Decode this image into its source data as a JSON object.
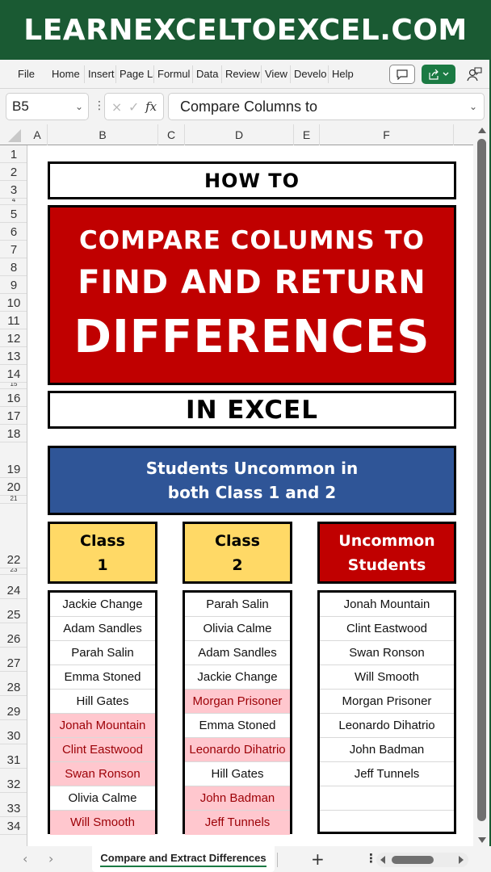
{
  "banner": {
    "text": "LEARNEXCELTOEXCEL.COM"
  },
  "ribbon": {
    "tabs": [
      "File",
      "Home",
      "Insert",
      "Page Layout",
      "Formulas",
      "Data",
      "Review",
      "View",
      "Developer",
      "Help"
    ],
    "tabs_visible": [
      "File",
      "Home",
      "Insert",
      "Page La",
      "Formul",
      "Data",
      "Review",
      "View",
      "Develo",
      "Help"
    ],
    "icons": [
      "comment-icon",
      "share-icon",
      "coauthor-icon"
    ]
  },
  "formula_bar": {
    "name_box": "B5",
    "cancel_icon": "×",
    "enter_icon": "✓",
    "fx_label": "fx",
    "content": "Compare Columns to"
  },
  "columns": [
    "A",
    "B",
    "C",
    "D",
    "E",
    "F"
  ],
  "rows": [
    "1",
    "2",
    "3",
    "4",
    "5",
    "6",
    "7",
    "8",
    "9",
    "10",
    "11",
    "12",
    "13",
    "14",
    "15",
    "16",
    "17",
    "18",
    "19",
    "20",
    "21",
    "22",
    "23",
    "24",
    "25",
    "26",
    "27",
    "28",
    "29",
    "30",
    "31",
    "32",
    "33",
    "34"
  ],
  "sheet": {
    "how_to": "HOW TO",
    "title_line1": "COMPARE COLUMNS TO",
    "title_line2": "FIND AND RETURN",
    "title_line3": "DIFFERENCES",
    "in_excel": "IN EXCEL",
    "subtitle_line1": "Students Uncommon in",
    "subtitle_line2": "both Class 1 and 2",
    "class1": {
      "header_line1": "Class",
      "header_line2": "1",
      "students": [
        {
          "name": "Jackie Change",
          "highlight": false
        },
        {
          "name": "Adam Sandles",
          "highlight": false
        },
        {
          "name": "Parah Salin",
          "highlight": false
        },
        {
          "name": "Emma Stoned",
          "highlight": false
        },
        {
          "name": "Hill Gates",
          "highlight": false
        },
        {
          "name": "Jonah Mountain",
          "highlight": true
        },
        {
          "name": "Clint Eastwood",
          "highlight": true
        },
        {
          "name": "Swan Ronson",
          "highlight": true
        },
        {
          "name": "Olivia Calme",
          "highlight": false
        },
        {
          "name": "Will Smooth",
          "highlight": true
        }
      ]
    },
    "class2": {
      "header_line1": "Class",
      "header_line2": "2",
      "students": [
        {
          "name": "Parah Salin",
          "highlight": false
        },
        {
          "name": "Olivia Calme",
          "highlight": false
        },
        {
          "name": "Adam Sandles",
          "highlight": false
        },
        {
          "name": "Jackie Change",
          "highlight": false
        },
        {
          "name": "Morgan Prisoner",
          "highlight": true
        },
        {
          "name": "Emma Stoned",
          "highlight": false
        },
        {
          "name": "Leonardo Dihatrio",
          "highlight": true
        },
        {
          "name": "Hill Gates",
          "highlight": false
        },
        {
          "name": "John Badman",
          "highlight": true
        },
        {
          "name": "Jeff Tunnels",
          "highlight": true
        }
      ]
    },
    "uncommon": {
      "header_line1": "Uncommon",
      "header_line2": "Students",
      "students": [
        {
          "name": "Jonah Mountain",
          "highlight": false
        },
        {
          "name": "Clint Eastwood",
          "highlight": false
        },
        {
          "name": "Swan Ronson",
          "highlight": false
        },
        {
          "name": "Will Smooth",
          "highlight": false
        },
        {
          "name": "Morgan Prisoner",
          "highlight": false
        },
        {
          "name": "Leonardo Dihatrio",
          "highlight": false
        },
        {
          "name": "John Badman",
          "highlight": false
        },
        {
          "name": "Jeff Tunnels",
          "highlight": false
        },
        {
          "name": "",
          "highlight": false
        },
        {
          "name": "",
          "highlight": false
        }
      ]
    }
  },
  "sheet_tabs": {
    "active": "Compare and Extract Differences",
    "add_label": "+",
    "more_label": "⋮",
    "prev_label": "‹",
    "next_label": "›"
  },
  "colors": {
    "brand_green": "#1a5a33",
    "title_red": "#c00000",
    "subtitle_blue": "#2f5597",
    "header_yellow": "#ffd966",
    "highlight_fill": "#ffc7ce",
    "highlight_text": "#9c0006"
  }
}
